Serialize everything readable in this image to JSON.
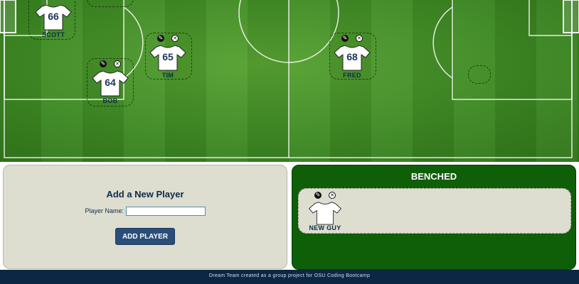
{
  "colors": {
    "pitch_green": "#3e8a24",
    "panel_bg": "#ddddd0",
    "bench_green": "#0f5e08",
    "button_blue": "#2a4d7a",
    "footer_navy": "#0c2744",
    "text_navy": "#0c2d48"
  },
  "icons": {
    "edit": "pencil-icon",
    "remove": "close-icon"
  },
  "players": [
    {
      "key": "scott",
      "number": "66",
      "name": "SCOTT"
    },
    {
      "key": "tim",
      "number": "65",
      "name": "TIM"
    },
    {
      "key": "bob",
      "number": "64",
      "name": "BOB"
    },
    {
      "key": "fred",
      "number": "68",
      "name": "FRED"
    }
  ],
  "add_player": {
    "title": "Add a New Player",
    "name_label": "Player Name:",
    "name_value": "",
    "button_label": "ADD PLAYER"
  },
  "bench": {
    "title": "BENCHED",
    "players": [
      {
        "number": "",
        "name": "NEW GUY"
      }
    ]
  },
  "footer": {
    "text": "Dream Team created as a group project for OSU Coding Bootcamp"
  }
}
